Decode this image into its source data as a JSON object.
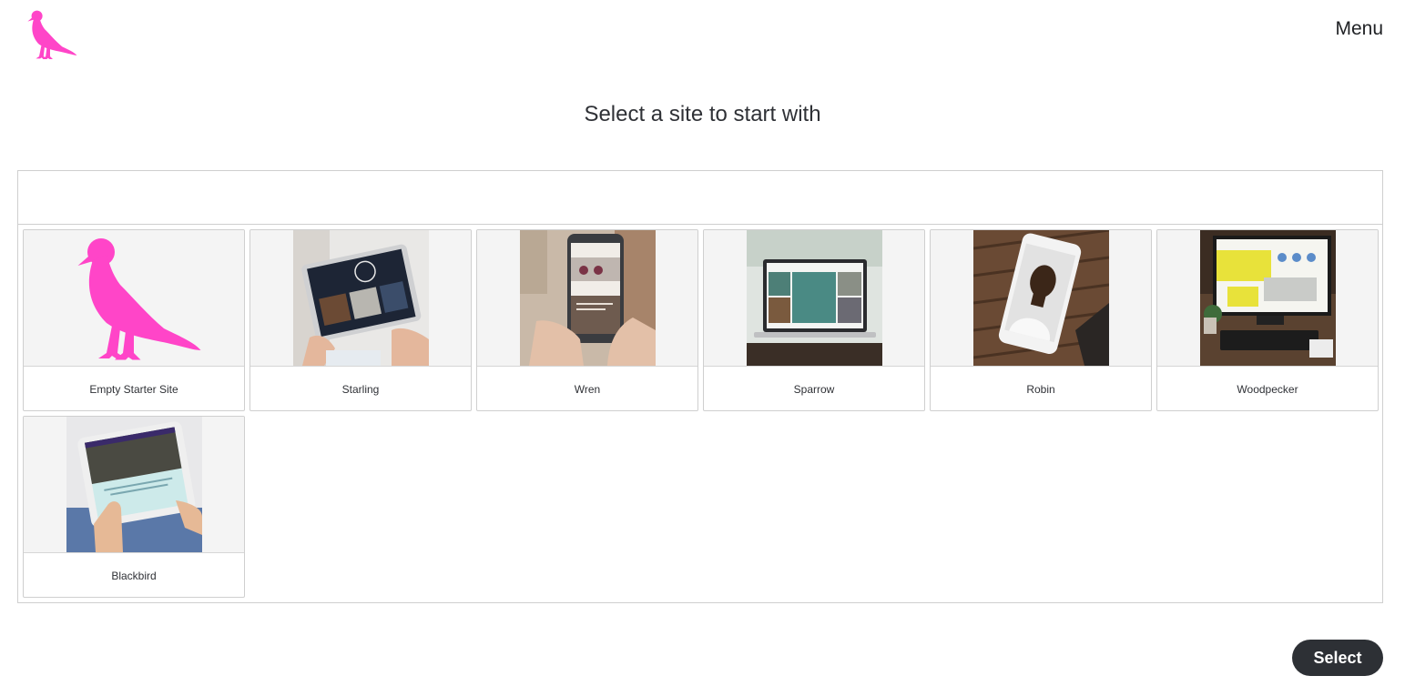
{
  "header": {
    "logo_icon": "pigeon-icon",
    "brand_color": "#ff45c8",
    "menu_label": "Menu"
  },
  "main": {
    "title": "Select a site to start with"
  },
  "sites": [
    {
      "label": "Empty Starter Site",
      "thumbnail": "pigeon-icon"
    },
    {
      "label": "Starling",
      "thumbnail": "tablet-photo"
    },
    {
      "label": "Wren",
      "thumbnail": "phone-photo"
    },
    {
      "label": "Sparrow",
      "thumbnail": "laptop-photo"
    },
    {
      "label": "Robin",
      "thumbnail": "phone-portrait-photo"
    },
    {
      "label": "Woodpecker",
      "thumbnail": "desktop-monitor-photo"
    },
    {
      "label": "Blackbird",
      "thumbnail": "tablet-hand-photo"
    }
  ],
  "footer": {
    "select_label": "Select"
  }
}
